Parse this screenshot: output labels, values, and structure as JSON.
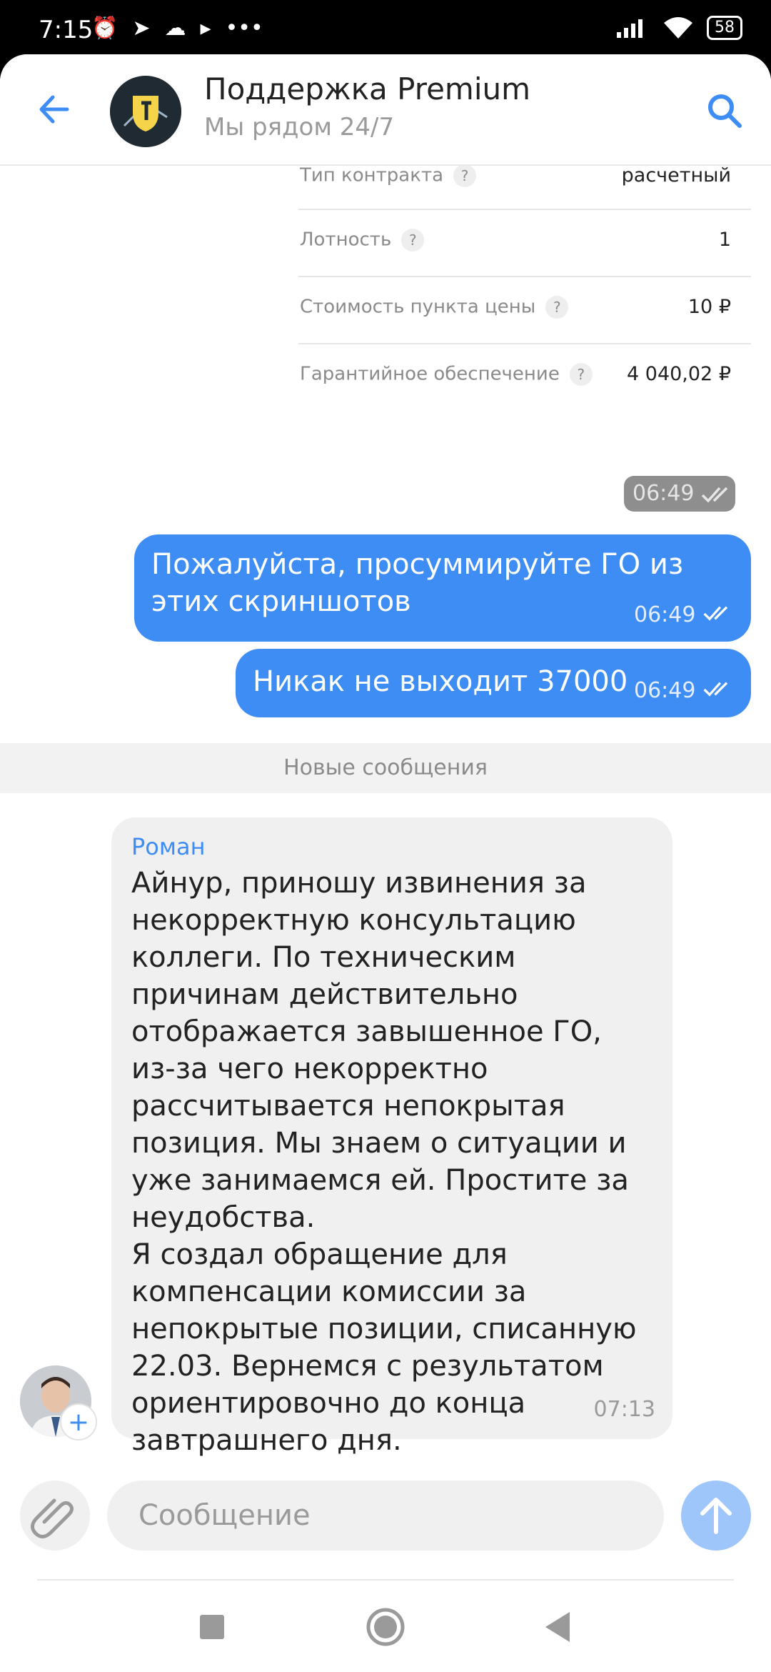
{
  "status_bar": {
    "time": "7:15",
    "battery": "58"
  },
  "header": {
    "title": "Поддержка Premium",
    "subtitle": "Мы рядом 24/7"
  },
  "params": [
    {
      "label": "Тип контракта",
      "hint": "?",
      "value": "расчетный"
    },
    {
      "label": "Лотность",
      "hint": "?",
      "value": "1"
    },
    {
      "label": "Стоимость пункта цены",
      "hint": "?",
      "value": "10 ₽"
    },
    {
      "label": "Гарантийное обеспечение",
      "hint": "?",
      "value": "4 040,02 ₽"
    }
  ],
  "image_time": "06:49",
  "outgoing": [
    {
      "text": "Пожалуйста, просуммируйте ГО из этих скриншотов",
      "time": "06:49",
      "status": "read"
    },
    {
      "text": "Никак не выходит 37000",
      "time": "06:49",
      "status": "read"
    }
  ],
  "divider": "Новые сообщения",
  "incoming": {
    "author": "Роман",
    "text": "Айнур, приношу извинения за некорректную консультацию коллеги. По техническим причинам действительно отображается завышенное ГО, из-за чего некорректно рассчитывается непокрытая позиция. Мы знаем о ситуации и уже занимаемся ей. Простите за неудобства.\nЯ создал обращение для компенсации комиссии за непокрытые позиции, списанную 22.03. Вернемся с результатом ориентировочно до конца завтрашнего дня.",
    "time": "07:13"
  },
  "composer": {
    "placeholder": "Сообщение"
  },
  "colors": {
    "accent": "#3d8df5",
    "send_disabled": "#9ec6fb"
  }
}
